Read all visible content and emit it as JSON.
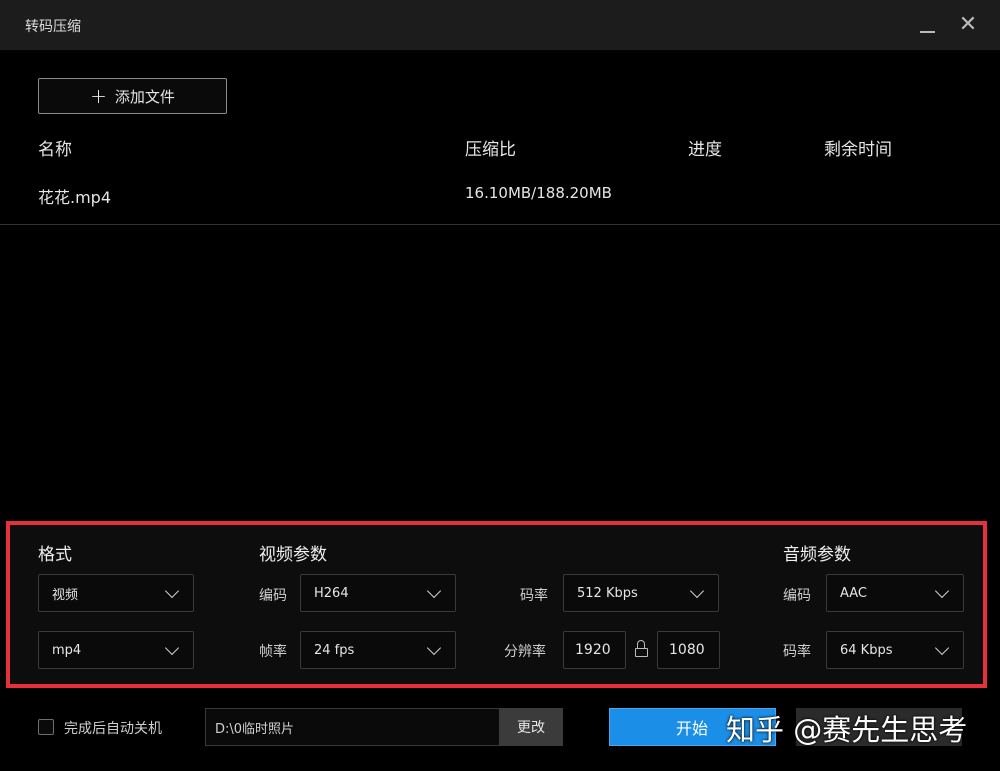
{
  "window": {
    "title": "转码压缩"
  },
  "toolbar": {
    "add_file_label": "添加文件"
  },
  "file_list": {
    "columns": {
      "name": "名称",
      "ratio": "压缩比",
      "progress": "进度",
      "remaining": "剩余时间"
    },
    "rows": [
      {
        "name": "花花.mp4",
        "ratio": "16.10MB/188.20MB",
        "progress": "",
        "remaining": ""
      }
    ]
  },
  "settings": {
    "format": {
      "title": "格式",
      "type_value": "视频",
      "container_value": "mp4"
    },
    "video": {
      "title": "视频参数",
      "codec_label": "编码",
      "codec_value": "H264",
      "framerate_label": "帧率",
      "framerate_value": "24 fps",
      "bitrate_label": "码率",
      "bitrate_value": "512 Kbps",
      "resolution_label": "分辨率",
      "width_value": "1920",
      "height_value": "1080"
    },
    "audio": {
      "title": "音频参数",
      "codec_label": "编码",
      "codec_value": "AAC",
      "bitrate_label": "码率",
      "bitrate_value": "64 Kbps"
    }
  },
  "footer": {
    "shutdown_label": "完成后自动关机",
    "shutdown_checked": false,
    "output_path": "D:\\0临时照片",
    "change_label": "更改",
    "start_label": "开始"
  },
  "watermark": {
    "text": "知乎 @赛先生思考"
  },
  "colors": {
    "highlight_border": "#e5323a",
    "start_button": "#1b8fe8",
    "background": "#000000"
  }
}
